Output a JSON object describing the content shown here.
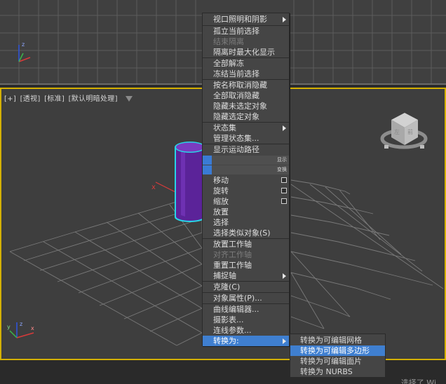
{
  "top_viewport": {},
  "perspective_viewport": {
    "label_parts": [
      "[+]",
      "[透视]",
      "[标准]",
      "[默认明暗处理]"
    ],
    "viewcube_labels": [
      "左",
      "前"
    ]
  },
  "bottom_bar": {
    "text": "选择了 Wi"
  },
  "quad_menu": {
    "items": [
      {
        "label": "视口照明和阴影",
        "state": "normal",
        "submenu": true
      },
      {
        "label": "孤立当前选择",
        "state": "normal"
      },
      {
        "label": "结束隔离",
        "state": "disabled"
      },
      {
        "label": "隔离时最大化显示",
        "state": "normal"
      },
      {
        "label": "全部解冻",
        "state": "normal"
      },
      {
        "label": "冻结当前选择",
        "state": "normal"
      },
      {
        "label": "按名称取消隐藏",
        "state": "normal"
      },
      {
        "label": "全部取消隐藏",
        "state": "normal"
      },
      {
        "label": "隐藏未选定对象",
        "state": "normal"
      },
      {
        "label": "隐藏选定对象",
        "state": "normal"
      },
      {
        "label": "状态集",
        "state": "normal",
        "submenu": true
      },
      {
        "label": "管理状态集...",
        "state": "normal"
      },
      {
        "label": "显示运动路径",
        "state": "normal"
      },
      {
        "label": "移动",
        "state": "normal",
        "options": true
      },
      {
        "label": "旋转",
        "state": "normal",
        "options": true
      },
      {
        "label": "缩放",
        "state": "normal",
        "options": true
      },
      {
        "label": "放置",
        "state": "normal"
      },
      {
        "label": "选择",
        "state": "normal"
      },
      {
        "label": "选择类似对象(S)",
        "state": "normal"
      },
      {
        "label": "放置工作轴",
        "state": "normal"
      },
      {
        "label": "对齐工作轴",
        "state": "disabled"
      },
      {
        "label": "重置工作轴",
        "state": "normal"
      },
      {
        "label": "捕捉轴",
        "state": "normal",
        "submenu": true
      },
      {
        "label": "克隆(C)",
        "state": "normal"
      },
      {
        "label": "对象属性(P)...",
        "state": "normal"
      },
      {
        "label": "曲线编辑器...",
        "state": "normal"
      },
      {
        "label": "摄影表...",
        "state": "normal"
      },
      {
        "label": "连线参数...",
        "state": "normal"
      },
      {
        "label": "转换为:",
        "state": "active",
        "submenu": true
      }
    ],
    "quad_tags": [
      "显示",
      "变换"
    ]
  },
  "submenu": {
    "items": [
      {
        "label": "转换为可编辑网格",
        "state": "normal"
      },
      {
        "label": "转换为可编辑多边形",
        "state": "active"
      },
      {
        "label": "转换为可编辑面片",
        "state": "normal"
      },
      {
        "label": "转换为 NURBS",
        "state": "normal"
      }
    ]
  },
  "colors": {
    "highlight": "#3f7fd0",
    "menu_bg": "#454545",
    "viewport_bg": "#3e3e3e",
    "active_viewport_border": "#d4b000",
    "cylinder": "#6a2ea8",
    "selection_outline": "#28d4e6"
  }
}
